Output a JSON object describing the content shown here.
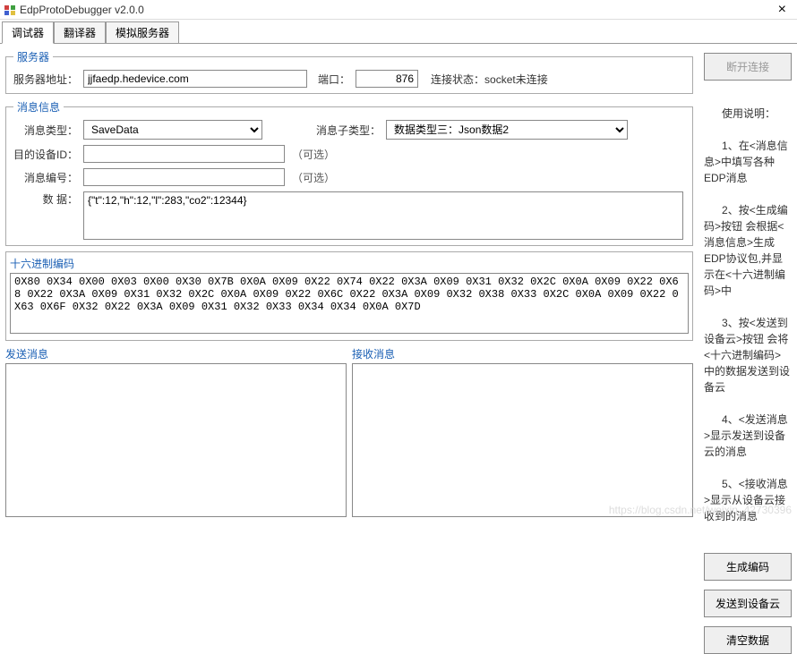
{
  "titlebar": {
    "title": "EdpProtoDebugger v2.0.0",
    "close": "×"
  },
  "tabs": {
    "t1": "调试器",
    "t2": "翻译器",
    "t3": "模拟服务器"
  },
  "server": {
    "legend": "服务器",
    "addr_label": "服务器地址：",
    "addr": "jjfaedp.hedevice.com",
    "port_label": "端口：",
    "port": "876",
    "status_label": "连接状态：",
    "status": "socket未连接"
  },
  "message": {
    "legend": "消息信息",
    "type_label": "消息类型：",
    "type_value": "SaveData",
    "subtype_label": "消息子类型：",
    "subtype_value": "数据类型三：Json数据2",
    "devid_label": "目的设备ID：",
    "devid": "",
    "msgnum_label": "消息编号：",
    "msgnum": "",
    "optional": "（可选）",
    "data_label": "数   据：",
    "data": "{\"t\":12,\"h\":12,\"l\":283,\"co2\":12344}"
  },
  "hex": {
    "legend": "十六进制编码",
    "content": "0X80 0X34 0X00 0X03 0X00 0X30 0X7B 0X0A 0X09 0X22 0X74 0X22 0X3A 0X09 0X31 0X32 0X2C 0X0A 0X09 0X22 0X68 0X22 0X3A 0X09 0X31 0X32 0X2C 0X0A 0X09 0X22 0X6C 0X22 0X3A 0X09 0X32 0X38 0X33 0X2C 0X0A 0X09 0X22 0X63 0X6F 0X32 0X22 0X3A 0X09 0X31 0X32 0X33 0X34 0X34 0X0A 0X7D"
  },
  "send": {
    "legend": "发送消息",
    "content": ""
  },
  "recv": {
    "legend": "接收消息",
    "content": ""
  },
  "buttons": {
    "disconnect": "断开连接",
    "gen": "生成编码",
    "send": "发送到设备云",
    "clear": "清空数据"
  },
  "help": {
    "title": "使用说明：",
    "s1": "1、在<消息信息>中填写各种EDP消息",
    "s2": "2、按<生成编码>按钮 会根据<消息信息>生成EDP协议包,并显示在<十六进制编码>中",
    "s3": "3、按<发送到设备云>按钮 会将<十六进制编码>中的数据发送到设备云",
    "s4": "4、<发送消息>显示发送到设备云的消息",
    "s5": "5、<接收消息>显示从设备云接收到的消息"
  },
  "watermark": "https://blog.csdn.net/weixin_42730396"
}
